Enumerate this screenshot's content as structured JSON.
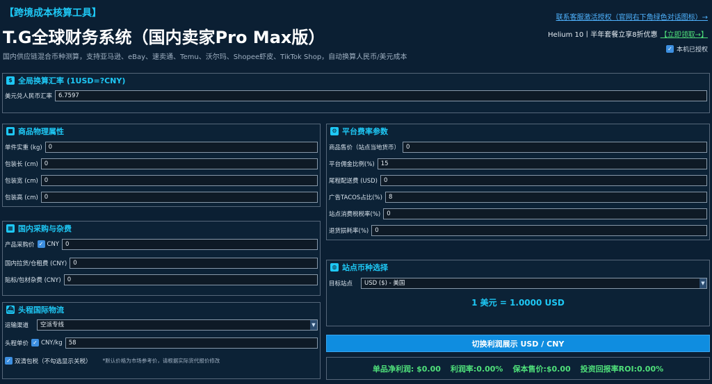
{
  "header": {
    "tool_name": "【跨境成本核算工具】",
    "main_title": "T.G全球财务系统（国内卖家Pro Max版）",
    "subtitle": "国内供应链混合币种测算，支持亚马逊、eBay、速卖通、Temu、沃尔玛、Shopee虾皮、TikTok Shop，自动换算人民币/美元成本",
    "contact_link": "联系客服激活授权（官网右下角绿色对话图标）→",
    "promo_text": "Helium 10丨半年套餐立享8折优惠",
    "promo_cta": "【立即领取→】",
    "authorized_label": "本机已授权",
    "authorized_checked": true
  },
  "exchange": {
    "title": "全局换算汇率 (1USD=?CNY)",
    "icon": "currency-exchange-icon",
    "label": "美元兑人民币汇率",
    "value": "6.7597"
  },
  "physical": {
    "title": "商品物理属性",
    "icon": "box-icon",
    "rows": [
      {
        "label": "单件实重 (kg)",
        "value": "0"
      },
      {
        "label": "包装长 (cm)",
        "value": "0"
      },
      {
        "label": "包装宽 (cm)",
        "value": "0"
      },
      {
        "label": "包装高 (cm)",
        "value": "0"
      }
    ]
  },
  "procurement": {
    "title": "国内采购与杂费",
    "icon": "factory-icon",
    "price_label": "产品采购价",
    "price_unit": "CNY",
    "price_unit_checked": true,
    "price_value": "0",
    "rows": [
      {
        "label": "国内拉货/仓租费 (CNY)",
        "value": "0"
      },
      {
        "label": "贴标/包材杂费 (CNY)",
        "value": "0"
      }
    ]
  },
  "logistics": {
    "title": "头程国际物流",
    "icon": "ship-icon",
    "channel_label": "运输渠道",
    "channel_value": "空派专线",
    "unit_price_label": "头程单价",
    "unit_price_unit": "CNY/kg",
    "unit_price_checked": true,
    "unit_price_value": "58",
    "dual_clear_label": "双清包税（不勾选显示关税）",
    "dual_clear_checked": true,
    "note": "*默认价格为市场参考价，请根据实际货代报价修改"
  },
  "platform": {
    "title": "平台费率参数",
    "icon": "gear-icon",
    "rows": [
      {
        "label": "商品售价（站点当地货币）",
        "value": "0"
      },
      {
        "label": "平台佣金比例(%)",
        "value": "15"
      },
      {
        "label": "尾程配送费 (USD)",
        "value": "0"
      },
      {
        "label": "广告TACOS占比(%)",
        "value": "8"
      },
      {
        "label": "站点消费税税率(%)",
        "value": "0"
      },
      {
        "label": "退货损耗率(%)",
        "value": "0"
      }
    ]
  },
  "site": {
    "title": "站点币种选择",
    "icon": "globe-icon",
    "target_label": "目标站点",
    "target_value": "USD ($) - 美国",
    "rate_display": "1 美元 = 1.0000 USD"
  },
  "toggle_button_label": "切换利润展示 USD / CNY",
  "results": {
    "net_profit": "单品净利润: $0.00",
    "margin": "利润率:0.00%",
    "breakeven": "保本售价:$0.00",
    "roi": "投资回报率ROI:0.00%"
  },
  "colors": {
    "background": "#0b1f33",
    "accent": "#1ec8f5",
    "button": "#0f8de0",
    "result_green": "#4fe07a",
    "link": "#4fb3ff"
  }
}
